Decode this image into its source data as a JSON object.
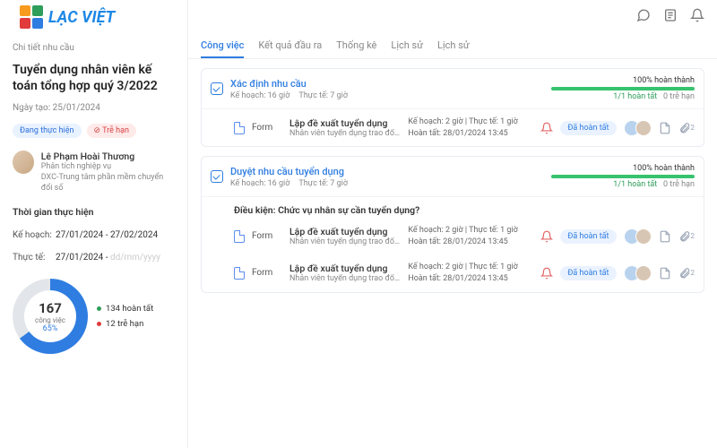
{
  "brand": {
    "name": "LẠC VIỆT"
  },
  "breadcrumb": "Chi tiết nhu cầu",
  "page": {
    "title": "Tuyển dụng nhân viên kế toán tổng hợp quý 3/2022",
    "created_label": "Ngày tạo:",
    "created_date": "25/01/2024",
    "status_doing": "Đang thực hiện",
    "status_late": "⊘ Trễ hạn"
  },
  "owner": {
    "name": "Lê Phạm Hoài Thương",
    "role": "Phân tích nghiệp vụ",
    "dept": "DXC-Trung tâm phần mềm chuyển đổi số"
  },
  "time": {
    "heading": "Thời gian thực hiện",
    "plan_label": "Kế hoạch:",
    "plan_value": "27/01/2024 - 27/02/2024",
    "actual_label": "Thực tế:",
    "actual_value": "27/01/2024 - ",
    "actual_placeholder": "dd/mm/yyyy"
  },
  "donut": {
    "count": "167",
    "label": "công việc",
    "percent": "65%",
    "done": "134 hoàn tất",
    "late": "12 trễ hạn"
  },
  "tabs": [
    "Công việc",
    "Kết quả đầu ra",
    "Thống kê",
    "Lịch sử",
    "Lịch sử"
  ],
  "groups": [
    {
      "title": "Xác định nhu cầu",
      "plan": "Kế hoạch: 16 giờ",
      "actual": "Thực tế: 7 giờ",
      "percent": "100% hoàn thành",
      "done": "1/1 hoàn tất",
      "late": "0 trễ hạn",
      "tasks": [
        {
          "title": "Lập đề xuất tuyển dụng",
          "desc": "Nhân viên tuyển dụng trao đổi lại với các ..",
          "info1": "Kế hoạch: 2 giờ | Thực tế: 1 giờ",
          "info2": "Hoàn tất: 28/01/2024 13:45",
          "status": "Đã hoàn tất"
        }
      ]
    },
    {
      "title": "Duyệt nhu cầu tuyển dụng",
      "plan": "Kế hoạch: 16 giờ",
      "actual": "Thực tế: 7 giờ",
      "percent": "100% hoàn thành",
      "done": "1/1 hoàn tất",
      "late": "0 trễ hạn",
      "condition": "Điều kiện: Chức vụ nhân sự cần tuyển dụng?",
      "tasks": [
        {
          "title": "Lập đề xuất tuyển dụng",
          "desc": "Nhân viên tuyển dụng trao đổi lại với các ..",
          "info1": "Kế hoạch: 2 giờ | Thực tế: 1 giờ",
          "info2": "Hoàn tất: 28/01/2024 13:45",
          "status": "Đã hoàn tất"
        },
        {
          "title": "Lập đề xuất tuyển dụng",
          "desc": "Nhân viên tuyển dụng trao đổi lại với các ..",
          "info1": "Kế hoạch: 2 giờ | Thực tế: 1 giờ",
          "info2": "Hoàn tất: 28/01/2024 13:45",
          "status": "Đã hoàn tất"
        }
      ]
    }
  ],
  "form_label": "Form",
  "attach_count": "2"
}
